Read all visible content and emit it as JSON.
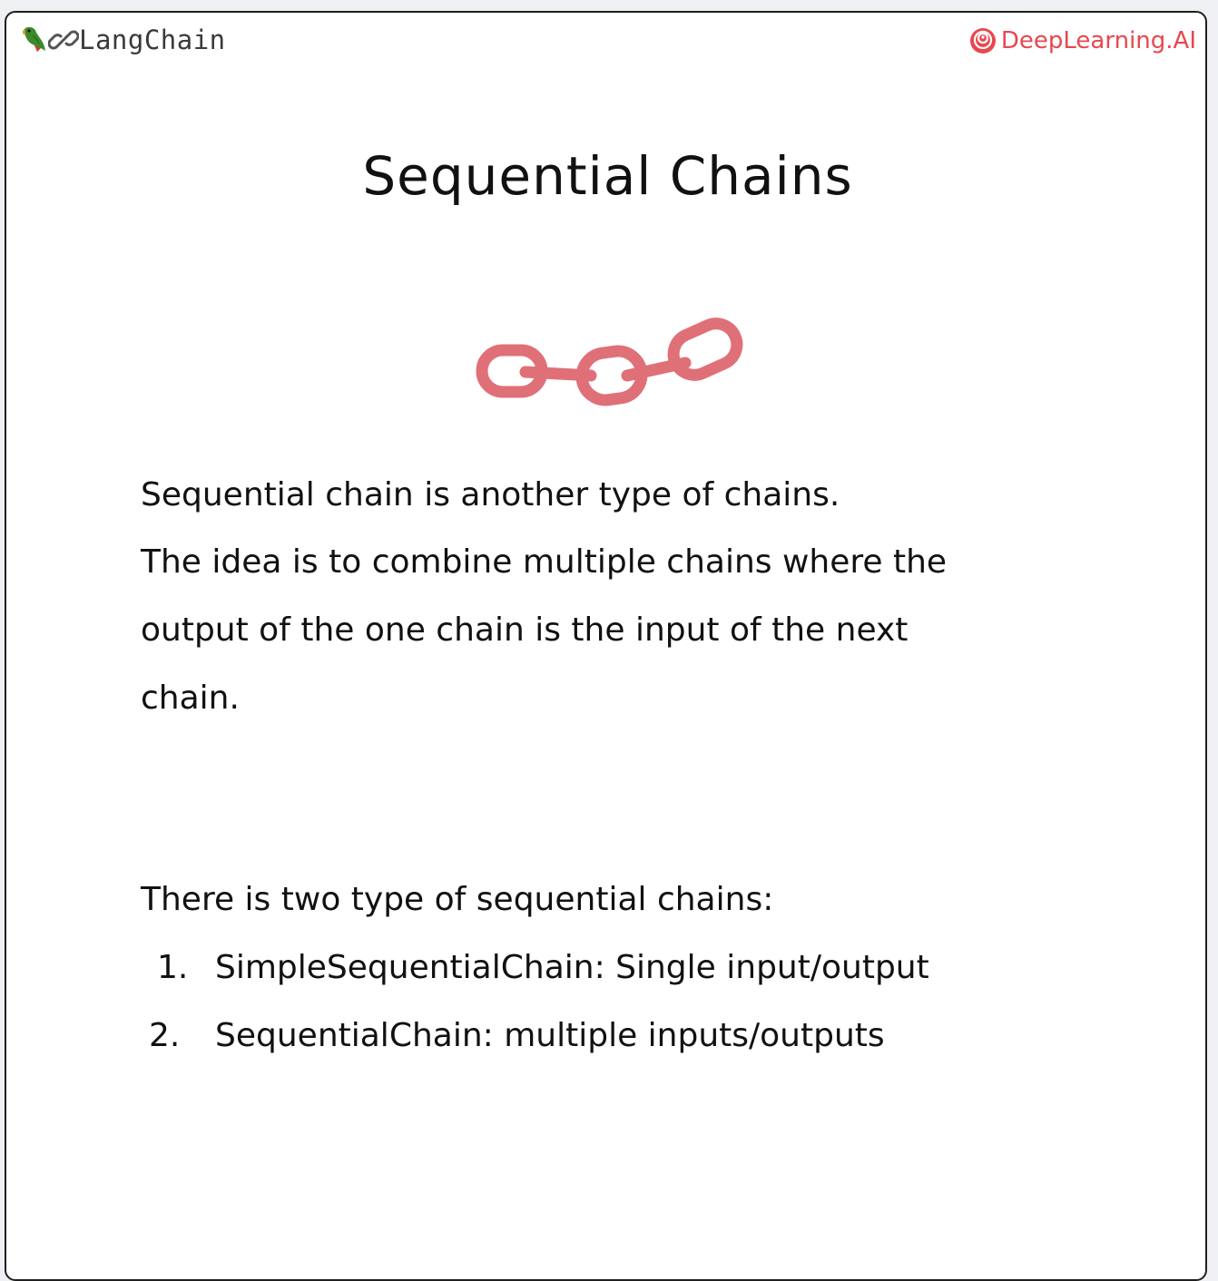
{
  "header": {
    "left_brand": "LangChain",
    "left_icons": [
      "parrot-icon",
      "link-icon"
    ],
    "right_brand": "DeepLearning.AI",
    "right_icon": "deeplearning-logo-icon"
  },
  "slide": {
    "title": "Sequential Chains",
    "illustration_icon": "chain-icon",
    "paragraph_lines": [
      "Sequential chain is another type of chains.",
      "The idea is to combine multiple chains where the",
      "output of the one chain is the input of the next",
      "chain."
    ],
    "list_intro": "There is two type of sequential chains:",
    "list_items": [
      {
        "number": "1.",
        "text": "SimpleSequentialChain: Single input/output"
      },
      {
        "number": "2.",
        "text": "SequentialChain: multiple inputs/outputs"
      }
    ]
  },
  "colors": {
    "brand_red": "#e8474f",
    "chain_pink": "#e07077",
    "text": "#111111"
  }
}
